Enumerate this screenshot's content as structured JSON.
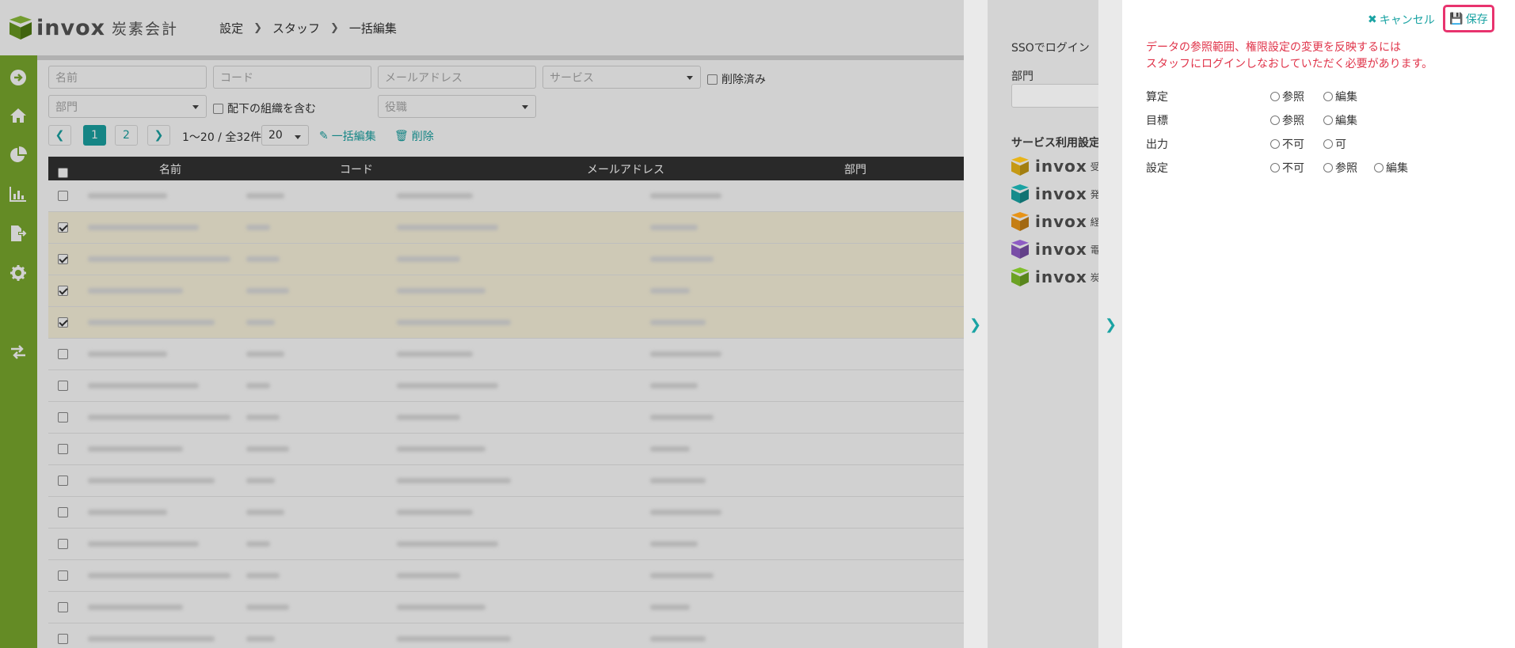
{
  "header": {
    "logo_text": "invox",
    "logo_sub": "炭素会計",
    "breadcrumb": [
      "設定",
      "スタッフ",
      "一括編集"
    ]
  },
  "sidebar": {
    "icons": [
      "arrow-right-circle-icon",
      "home-icon",
      "pie-chart-icon",
      "bar-chart-icon",
      "file-export-icon",
      "gear-icon",
      "exchange-icon"
    ]
  },
  "filters": {
    "name_placeholder": "名前",
    "code_placeholder": "コード",
    "email_placeholder": "メールアドレス",
    "service_placeholder": "サービス",
    "deleted_label": "削除済み",
    "department_placeholder": "部門",
    "include_sub_label": "配下の組織を含む",
    "position_placeholder": "役職"
  },
  "pagination": {
    "pages": [
      "1",
      "2"
    ],
    "active_page": "1",
    "range_text": "1〜20 / 全32件",
    "per_page": "20",
    "bulk_edit_label": "一括編集",
    "delete_label": "削除"
  },
  "table": {
    "headers": [
      "名前",
      "コード",
      "メールアドレス",
      "部門"
    ],
    "rows": [
      {
        "checked": false
      },
      {
        "checked": true
      },
      {
        "checked": true
      },
      {
        "checked": true
      },
      {
        "checked": true
      },
      {
        "checked": false
      },
      {
        "checked": false
      },
      {
        "checked": false
      },
      {
        "checked": false
      },
      {
        "checked": false
      },
      {
        "checked": false
      },
      {
        "checked": false
      },
      {
        "checked": false
      },
      {
        "checked": false
      },
      {
        "checked": false
      }
    ]
  },
  "panel1": {
    "sso_label": "SSOでログイン",
    "department_label": "部門",
    "service_settings_label": "サービス利用設定",
    "services": [
      {
        "name": "invox",
        "sub": "受",
        "color": "#e8b418"
      },
      {
        "name": "invox",
        "sub": "発",
        "color": "#1aa3a3"
      },
      {
        "name": "invox",
        "sub": "経",
        "color": "#e89418"
      },
      {
        "name": "invox",
        "sub": "電",
        "color": "#8e5cc4"
      },
      {
        "name": "invox",
        "sub": "炭",
        "color": "#7fbf2a"
      }
    ]
  },
  "panel2": {
    "cancel_label": "キャンセル",
    "save_label": "保存",
    "warning_line1": "データの参照範囲、権限設定の変更を反映するには",
    "warning_line2": "スタッフにログインしなおしていただく必要があります。",
    "permissions": [
      {
        "label": "算定",
        "options": [
          "参照",
          "編集"
        ]
      },
      {
        "label": "目標",
        "options": [
          "参照",
          "編集"
        ]
      },
      {
        "label": "出力",
        "options": [
          "不可",
          "可"
        ]
      },
      {
        "label": "設定",
        "options": [
          "不可",
          "参照",
          "編集"
        ]
      }
    ]
  },
  "colors": {
    "brand_green": "#7aaa2e",
    "teal": "#1aa3a3",
    "warning_red": "#e0344a",
    "highlight_pink": "#e8336e"
  }
}
